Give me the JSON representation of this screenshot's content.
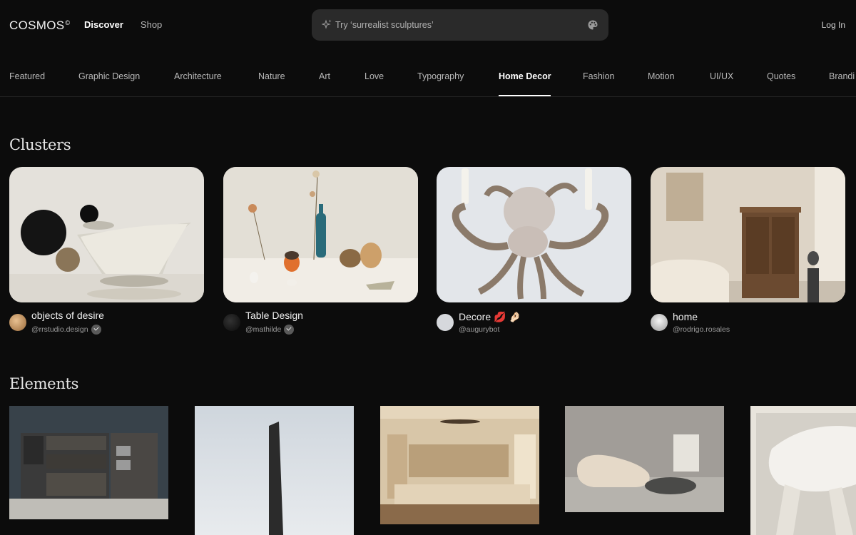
{
  "brand": {
    "logo": "COSMOS",
    "mark": "©"
  },
  "topnav": {
    "discover": "Discover",
    "shop": "Shop"
  },
  "search": {
    "placeholder": "Try ‘surrealist sculptures’",
    "value": ""
  },
  "auth": {
    "login": "Log In"
  },
  "categories": [
    "Featured",
    "Graphic Design",
    "Architecture",
    "Nature",
    "Art",
    "Love",
    "Typography",
    "Home Decor",
    "Fashion",
    "Motion",
    "UI/UX",
    "Quotes",
    "Brandi"
  ],
  "active_category": "Home Decor",
  "sections": {
    "clusters": "Clusters",
    "elements": "Elements"
  },
  "clusters": [
    {
      "name": "objects of desire",
      "handle": "@rrstudio.design",
      "verified": true
    },
    {
      "name": "Table Design",
      "handle": "@mathilde",
      "verified": true
    },
    {
      "name": "Decore 💋 🤌🏻",
      "handle": "@augurybot",
      "verified": false
    },
    {
      "name": "home",
      "handle": "@rodrigo.rosales",
      "verified": false
    }
  ],
  "elements": [
    "kitchen-cabinet-image",
    "monolith-image",
    "living-room-image",
    "curved-sofa-image",
    "white-chair-image"
  ],
  "colors": {
    "background": "#0c0c0c",
    "search_bg": "#2a2a2a",
    "accent": "#ffffff"
  }
}
